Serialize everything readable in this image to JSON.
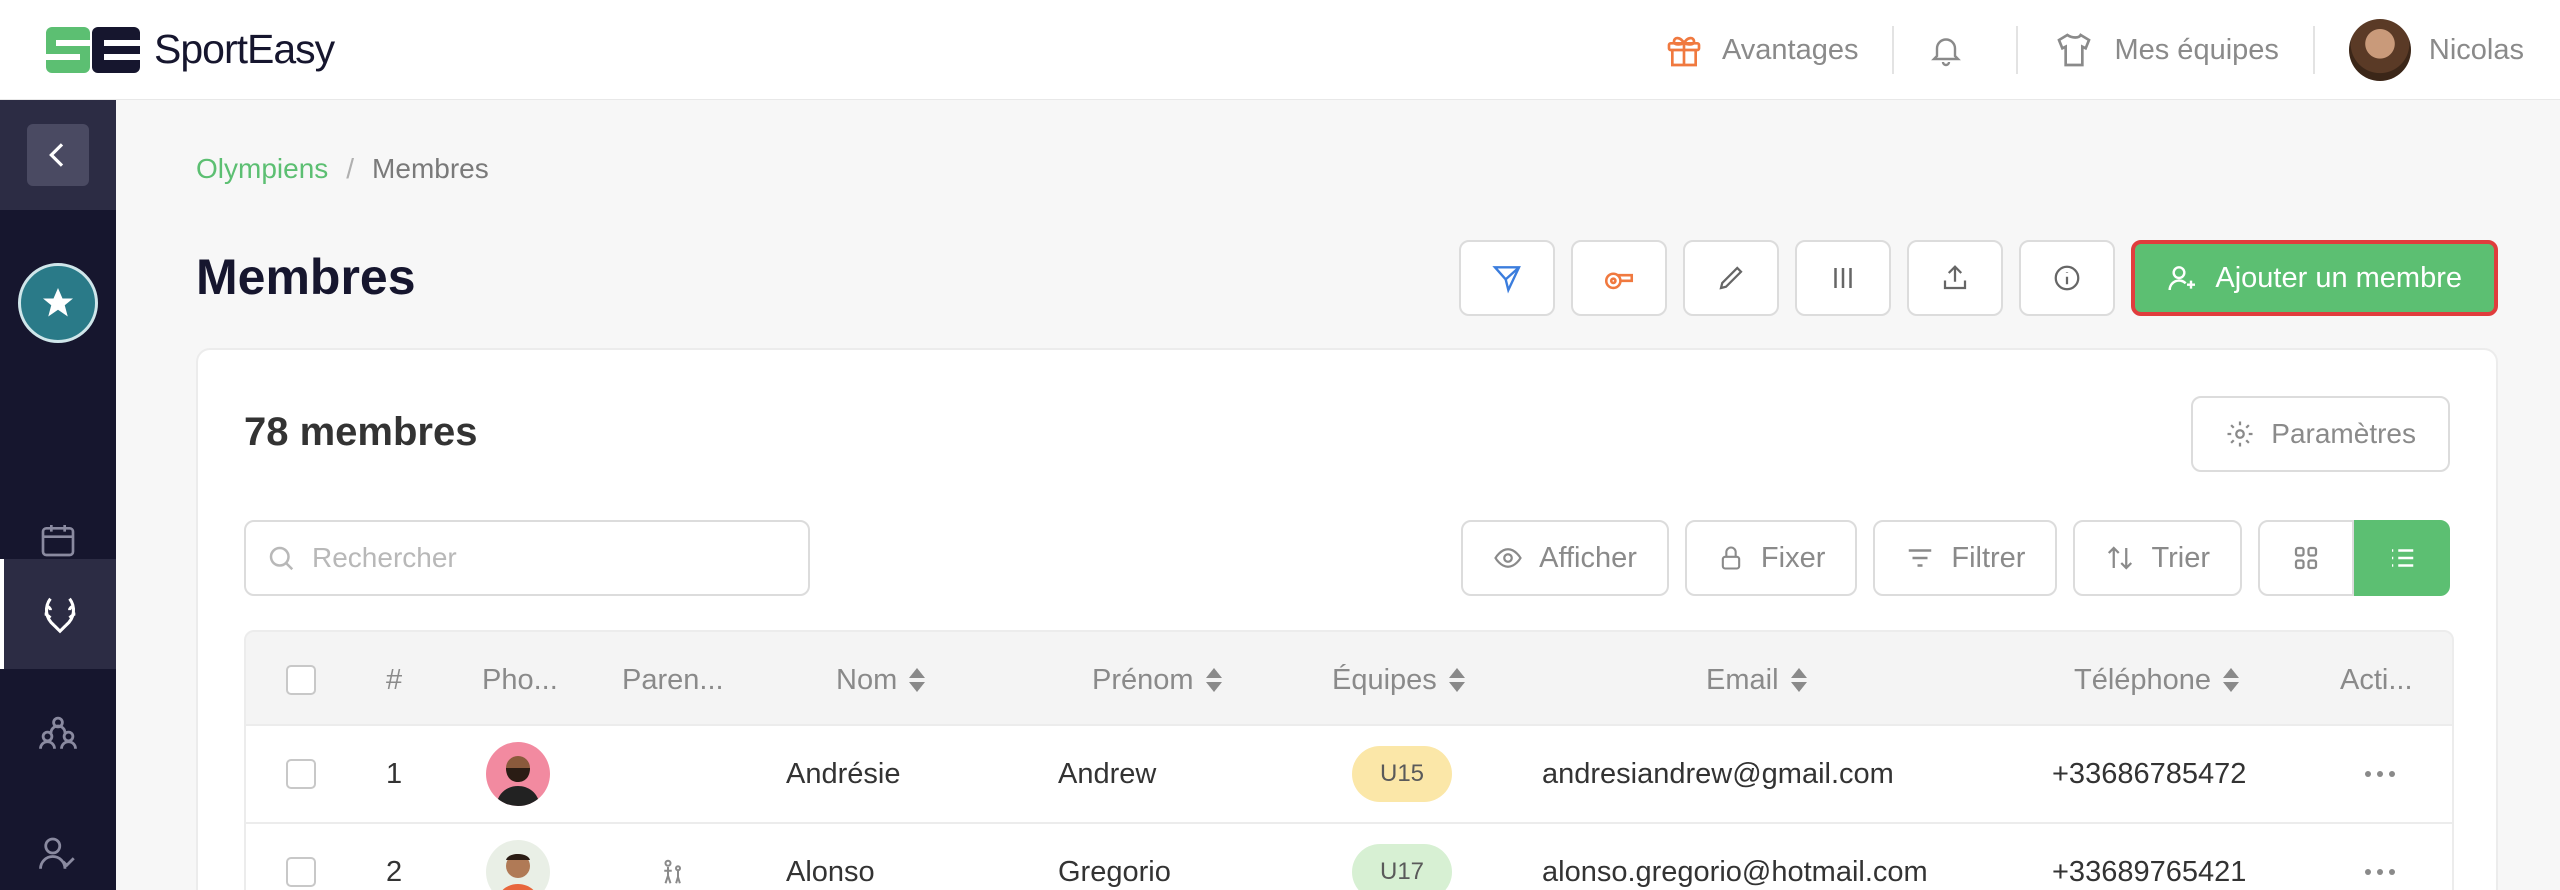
{
  "app": {
    "brand": "SportEasy"
  },
  "topnav": {
    "advantages": "Avantages",
    "my_teams": "Mes équipes",
    "user": "Nicolas"
  },
  "breadcrumb": {
    "club": "Olympiens",
    "sep": "/",
    "current": "Membres"
  },
  "page": {
    "title": "Membres"
  },
  "toolbar": {
    "add_member": "Ajouter un membre"
  },
  "card": {
    "title": "78 membres",
    "params": "Paramètres",
    "search_placeholder": "Rechercher",
    "show": "Afficher",
    "pin": "Fixer",
    "filter": "Filtrer",
    "sort": "Trier"
  },
  "table": {
    "headers": {
      "num": "#",
      "photo": "Pho...",
      "parents": "Paren...",
      "last_name": "Nom",
      "first_name": "Prénom",
      "teams": "Équipes",
      "email": "Email",
      "phone": "Téléphone",
      "actions": "Acti..."
    },
    "rows": [
      {
        "num": "1",
        "last_name": "Andrésie",
        "first_name": "Andrew",
        "team": "U15",
        "team_color": "#fbe7a8",
        "email": "andresiandrew@gmail.com",
        "phone": "+33686785472"
      },
      {
        "num": "2",
        "last_name": "Alonso",
        "first_name": "Gregorio",
        "team": "U17",
        "team_color": "#d7f0d3",
        "email": "alonso.gregorio@hotmail.com",
        "phone": "+33689765421"
      }
    ]
  },
  "colors": {
    "accent": "#5cbf72",
    "sidebar": "#16162e",
    "highlight": "#e03d3d"
  }
}
